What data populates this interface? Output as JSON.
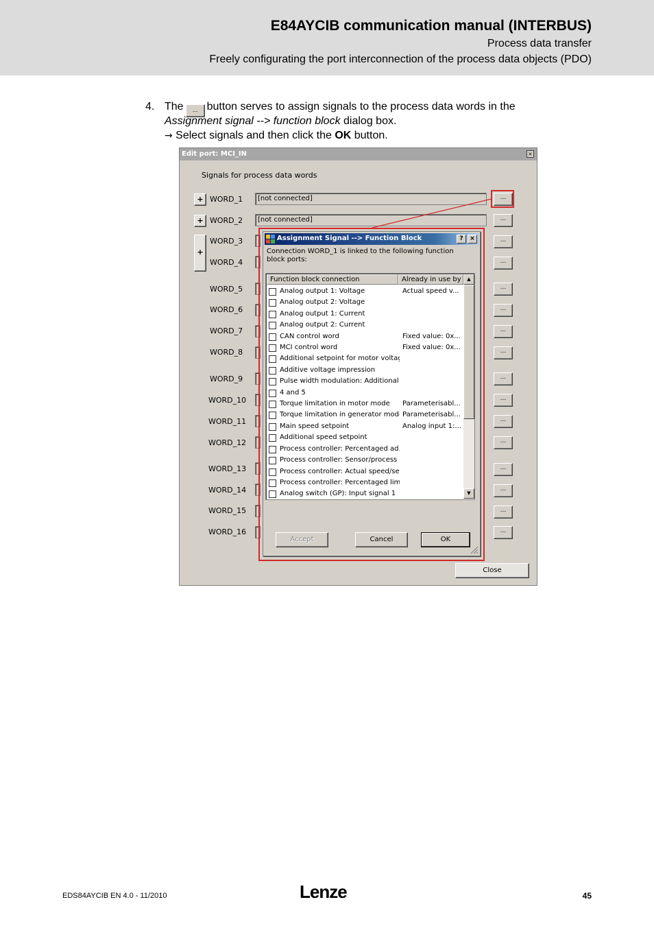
{
  "header": {
    "title": "E84AYCIB communication manual (INTERBUS)",
    "subtitle1": "Process data transfer",
    "subtitle2": "Freely configurating the port interconnection of the process data objects (PDO)"
  },
  "instruction": {
    "number": "4.",
    "line1_a": "The",
    "button_label": "...",
    "line1_b": "button serves to assign signals to the process data words in the",
    "line2_italic": "Assignment signal --> function block",
    "line2_b": " dialog box.",
    "arrow": "→",
    "line3_a": " Select signals and then click the ",
    "line3_bold": "OK",
    "line3_b": " button."
  },
  "edit_port": {
    "title": "Edit port: MCI_IN",
    "close_glyph": "×",
    "caption": "Signals for process data words",
    "plus_label": "+",
    "dots_label": "...",
    "field_value": "[not connected]",
    "words": [
      "WORD_1",
      "WORD_2",
      "WORD_3",
      "WORD_4",
      "WORD_5",
      "WORD_6",
      "WORD_7",
      "WORD_8",
      "WORD_9",
      "WORD_10",
      "WORD_11",
      "WORD_12",
      "WORD_13",
      "WORD_14",
      "WORD_15",
      "WORD_16"
    ],
    "close_button": "Close"
  },
  "assignment_dialog": {
    "title": "Assignment Signal --> Function Block",
    "help_glyph": "?",
    "close_glyph": "×",
    "message": "Connection WORD_1 is linked to the following function block ports:",
    "columns": [
      "Function block connection",
      "Already in use by"
    ],
    "rows": [
      {
        "name": "Analog output 1: Voltage",
        "use": "Actual speed v..."
      },
      {
        "name": "Analog output 2: Voltage",
        "use": ""
      },
      {
        "name": "Analog output 1: Current",
        "use": ""
      },
      {
        "name": "Analog output 2: Current",
        "use": ""
      },
      {
        "name": "CAN control word",
        "use": "Fixed value: 0x..."
      },
      {
        "name": "MCI control word",
        "use": "Fixed value: 0x..."
      },
      {
        "name": "Additional setpoint for motor voltage...",
        "use": ""
      },
      {
        "name": "Additive voltage impression",
        "use": ""
      },
      {
        "name": "Pulse width modulation: Additional o...",
        "use": ""
      },
      {
        "name": " 4 and 5",
        "use": ""
      },
      {
        "name": "Torque limitation in motor mode",
        "use": "Parameterisabl..."
      },
      {
        "name": "Torque limitation in generator mode",
        "use": "Parameterisabl..."
      },
      {
        "name": "Main speed setpoint",
        "use": "Analog input 1:..."
      },
      {
        "name": "Additional speed setpoint",
        "use": ""
      },
      {
        "name": "Process controller: Percentaged ad...",
        "use": ""
      },
      {
        "name": "Process controller: Sensor/process ...",
        "use": ""
      },
      {
        "name": "Process controller: Actual speed/se...",
        "use": ""
      },
      {
        "name": "Process controller: Percentaged limi...",
        "use": ""
      },
      {
        "name": "Analog switch (GP): Input signal 1",
        "use": ""
      }
    ],
    "scroll_up": "▲",
    "scroll_down": "▼",
    "buttons": {
      "accept": "Accept",
      "cancel": "Cancel",
      "ok": "OK"
    }
  },
  "highlight_color": "#d22a2a",
  "footer": {
    "doc_id": "EDS84AYCIB EN 4.0 - 11/2010",
    "logo": "Lenze",
    "page": "45"
  }
}
